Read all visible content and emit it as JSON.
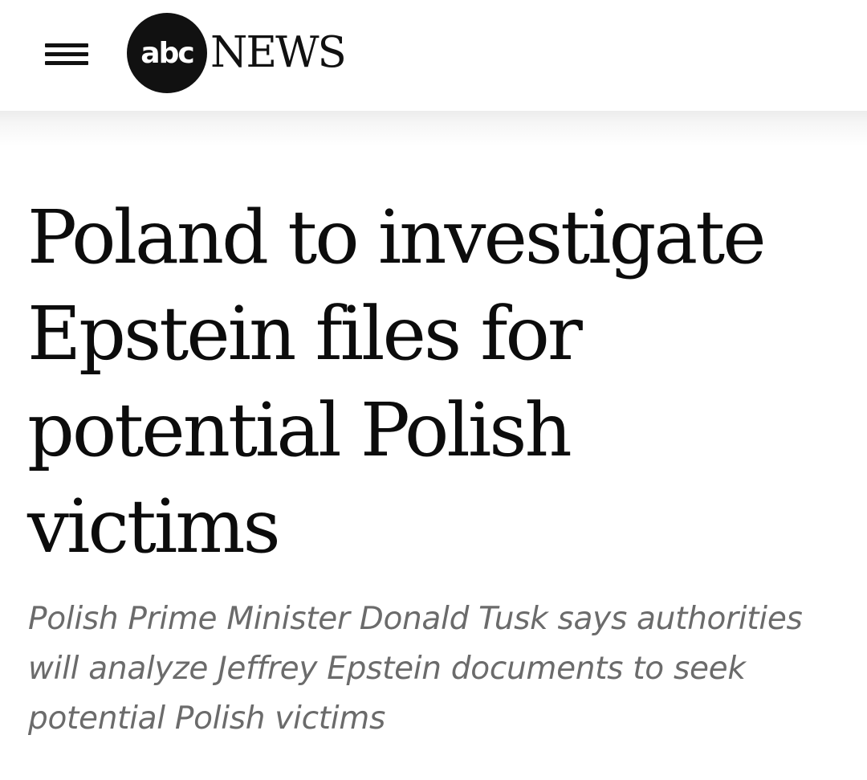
{
  "header": {
    "menu_icon": "hamburger-menu-icon",
    "logo": {
      "badge_text": "abc",
      "wordmark": "NEWS",
      "badge_color": "#111111"
    }
  },
  "article": {
    "headline": "Poland to investigate Epstein files for potential Polish victims",
    "subheadline": "Polish Prime Minister Donald Tusk says authorities will analyze Jeffrey Epstein documents to seek potential Polish victims"
  },
  "colors": {
    "headline": "#0c0c0c",
    "subheadline": "#6b6b6b",
    "background": "#ffffff"
  }
}
